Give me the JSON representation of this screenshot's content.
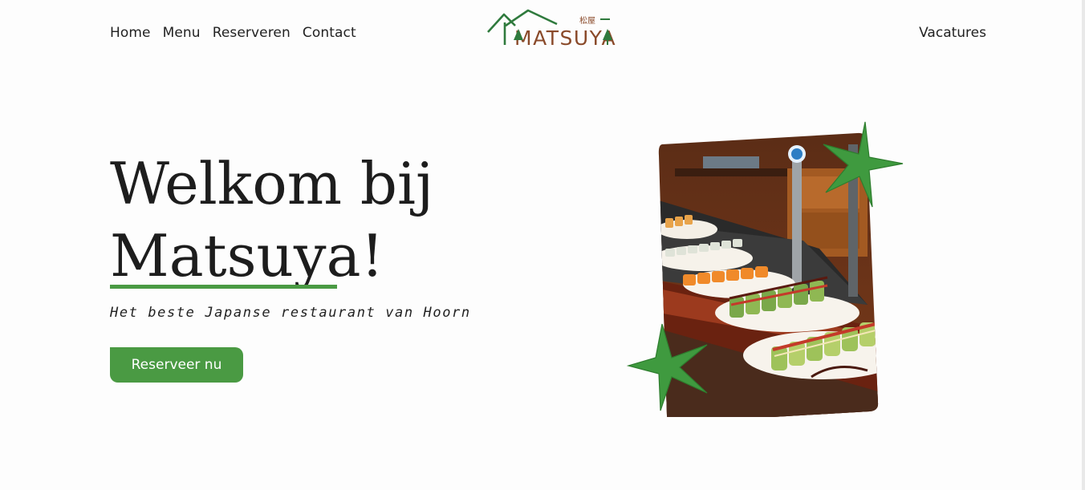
{
  "header": {
    "nav": [
      "Home",
      "Menu",
      "Reserveren",
      "Contact"
    ],
    "logo_text": "MATSUYA",
    "logo_kanji": "松屋",
    "vacatures": "Vacatures"
  },
  "hero": {
    "title_line1": "Welkom bij",
    "title_line2_word": "Matsuya",
    "title_line2_punct": "!",
    "subtitle": "Het beste Japanse restaurant van Hoorn",
    "cta": "Reserveer nu"
  },
  "colors": {
    "accent_green": "#4a9a43",
    "logo_green": "#2f7a3d",
    "logo_brown": "#8a4a2a"
  }
}
